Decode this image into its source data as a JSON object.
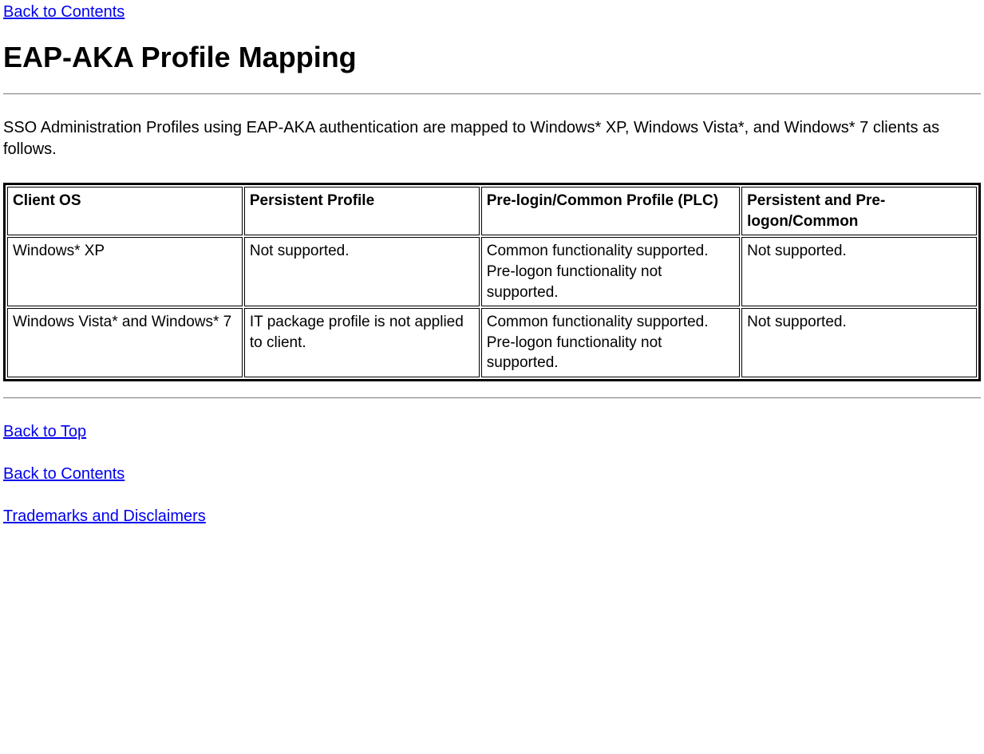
{
  "links": {
    "back_to_contents_top": "Back to Contents",
    "back_to_top": "Back to Top",
    "back_to_contents_bottom": "Back to Contents",
    "trademarks": "Trademarks and Disclaimers"
  },
  "heading": "EAP-AKA Profile Mapping",
  "description": "SSO Administration Profiles using EAP-AKA authentication are mapped to Windows* XP, Windows Vista*, and Windows* 7 clients as follows.",
  "table": {
    "headers": {
      "c1": "Client OS",
      "c2": "Persistent Profile",
      "c3": "Pre-login/Common Profile (PLC)",
      "c4": "Persistent and Pre-logon/Common"
    },
    "rows": [
      {
        "c1": "Windows* XP",
        "c2": "Not supported.",
        "c3a": "Common functionality supported.",
        "c3b": "Pre-logon functionality not supported.",
        "c4": "Not supported."
      },
      {
        "c1": "Windows Vista* and Windows* 7",
        "c2": "IT package profile is not applied to client.",
        "c3a": "Common functionality supported.",
        "c3b": "Pre-logon functionality not supported.",
        "c4": "Not supported."
      }
    ]
  }
}
